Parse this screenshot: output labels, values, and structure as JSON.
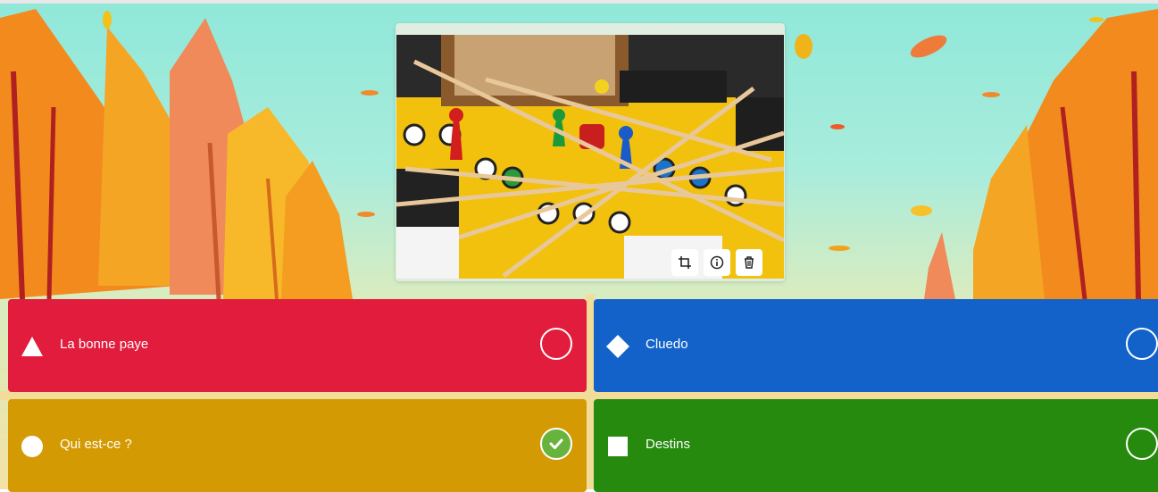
{
  "question_image": {
    "tools": [
      "crop-icon",
      "info-icon",
      "trash-icon"
    ]
  },
  "answers": [
    {
      "text": "La bonne paye",
      "shape": "triangle",
      "color": "#e11c3c",
      "correct": false
    },
    {
      "text": "Cluedo",
      "shape": "diamond",
      "color": "#1262c9",
      "correct": false
    },
    {
      "text": "Qui est-ce ?",
      "shape": "circle",
      "color": "#d49a04",
      "correct": true
    },
    {
      "text": "Destins",
      "shape": "square",
      "color": "#258a0e",
      "correct": false
    }
  ]
}
